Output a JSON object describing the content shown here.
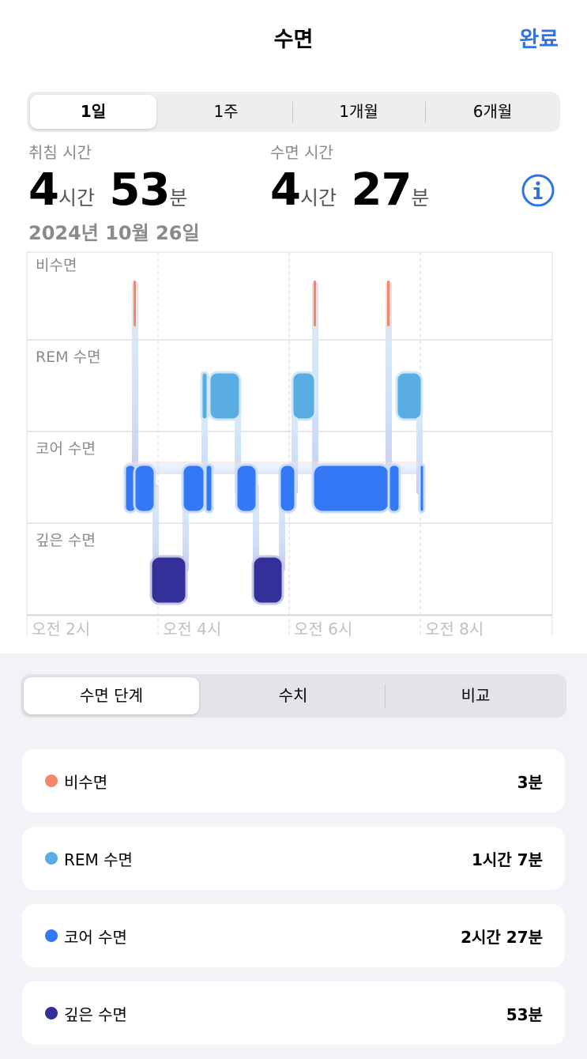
{
  "header": {
    "title": "수면",
    "done_label": "완료"
  },
  "range_tabs": [
    "1일",
    "1주",
    "1개월",
    "6개월"
  ],
  "summary": {
    "in_bed_label": "취침 시간",
    "in_bed_hours": "4",
    "in_bed_hours_unit": "시간",
    "in_bed_minutes": "53",
    "in_bed_minutes_unit": "분",
    "asleep_label": "수면 시간",
    "asleep_hours": "4",
    "asleep_hours_unit": "시간",
    "asleep_minutes": "27",
    "asleep_minutes_unit": "분",
    "date": "2024년 10월 26일"
  },
  "chart_data": {
    "type": "sleep-stages",
    "stages": [
      "비수면",
      "REM 수면",
      "코어 수면",
      "깊은 수면"
    ],
    "x_ticks": [
      "오전 2시",
      "오전 4시",
      "오전 6시",
      "오전 8시"
    ]
  },
  "detail_tabs": [
    "수면 단계",
    "수치",
    "비교"
  ],
  "stages": [
    {
      "name": "비수면",
      "value": "3분",
      "color": "#f4866c"
    },
    {
      "name": "REM 수면",
      "value": "1시간 7분",
      "color": "#5aade2"
    },
    {
      "name": "코어 수면",
      "value": "2시간 27분",
      "color": "#3478f6"
    },
    {
      "name": "깊은 수면",
      "value": "53분",
      "color": "#33309a"
    }
  ]
}
